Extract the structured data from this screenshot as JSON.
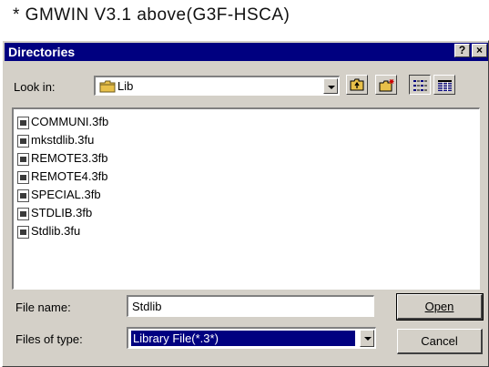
{
  "caption": "* GMWIN V3.1 above(G3F-HSCA)",
  "dialog": {
    "title": "Directories",
    "help_glyph": "?",
    "close_glyph": "×",
    "look_in_label": "Look in:",
    "look_in_value": "Lib",
    "file_list": [
      "COMMUNI.3fb",
      "mkstdlib.3fu",
      "REMOTE3.3fb",
      "REMOTE4.3fb",
      "SPECIAL.3fb",
      "STDLIB.3fb",
      "Stdlib.3fu"
    ],
    "file_name_label": "File name:",
    "file_name_value": "Stdlib",
    "files_of_type_label": "Files of type:",
    "files_of_type_value": "Library File(*.3*)",
    "open_button": "Open",
    "cancel_button": "Cancel",
    "colors": {
      "titlebar": "#000080",
      "face": "#d4d0c8",
      "selection": "#000080"
    }
  }
}
